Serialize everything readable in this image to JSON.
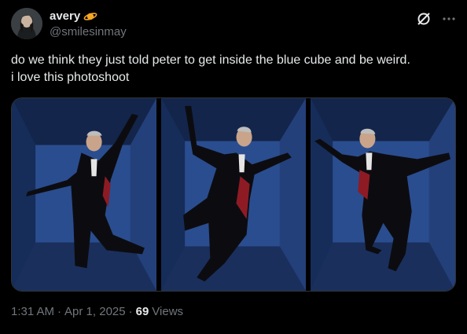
{
  "author": {
    "display_name": "avery",
    "handle": "@smilesinmay",
    "badge_icon": "planet-icon",
    "badge_color": "#f5a623"
  },
  "header_icons": [
    "grok-icon",
    "more-icon"
  ],
  "tweet": {
    "text_line_1": "do we think they just told peter to get inside the blue cube and be weird.",
    "text_line_2": "i love this photoshoot"
  },
  "media": {
    "count": 3,
    "background_color": "#1d3a6e"
  },
  "meta": {
    "time": "1:31 AM",
    "separator_1": "·",
    "date": "Apr 1, 2025",
    "separator_2": "·",
    "views_count": "69",
    "views_label": "Views"
  }
}
